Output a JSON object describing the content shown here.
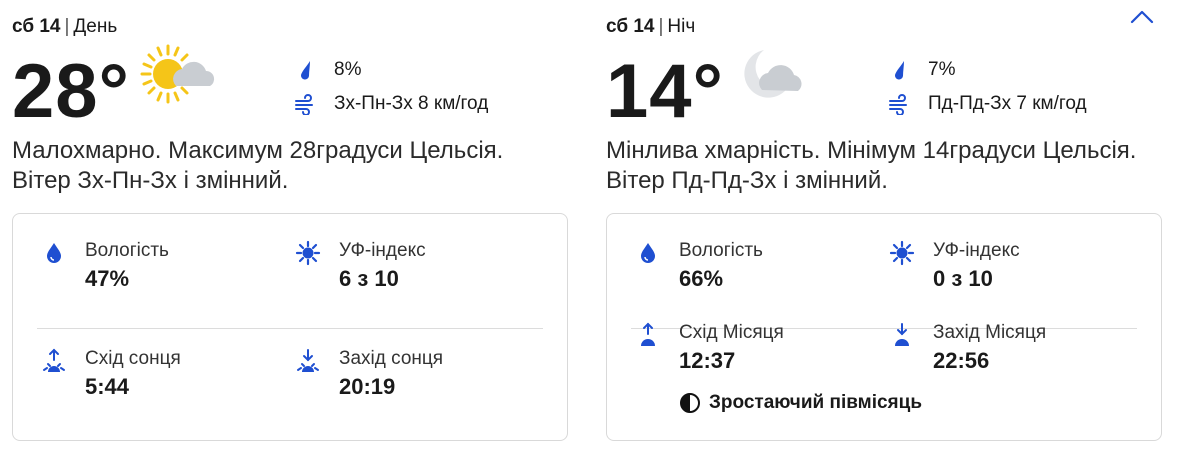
{
  "day": {
    "date": "сб 14",
    "period": "День",
    "temperature": "28°",
    "weather_icon": "sun-cloud-icon",
    "precipitation": "8%",
    "wind": "Зх-Пн-Зх 8 км/год",
    "description": "Малохмарно. Максимум 28градуси Цельсія. Вітер Зх-Пн-Зх і змінний.",
    "details": {
      "humidity_label": "Вологість",
      "humidity_value": "47%",
      "uv_label": "УФ-індекс",
      "uv_value": "6 з 10",
      "sunrise_label": "Схід сонця",
      "sunrise_value": "5:44",
      "sunset_label": "Захід сонця",
      "sunset_value": "20:19"
    }
  },
  "night": {
    "date": "сб 14",
    "period": "Ніч",
    "temperature": "14°",
    "weather_icon": "moon-cloud-icon",
    "precipitation": "7%",
    "wind": "Пд-Пд-Зх 7 км/год",
    "description": "Мінлива хмарність. Мінімум 14градуси Цельсія. Вітер Пд-Пд-Зх і змінний.",
    "details": {
      "humidity_label": "Вологість",
      "humidity_value": "66%",
      "uv_label": "УФ-індекс",
      "uv_value": "0 з 10",
      "moonrise_label": "Схід Місяця",
      "moonrise_value": "12:37",
      "moonset_label": "Захід Місяця",
      "moonset_value": "22:56",
      "moon_phase": "Зростаючий півмісяць"
    }
  },
  "colors": {
    "accent": "#1f4fd1",
    "sun": "#f5c518",
    "cloud": "#c9cdd2",
    "border": "#d9d9d9"
  }
}
